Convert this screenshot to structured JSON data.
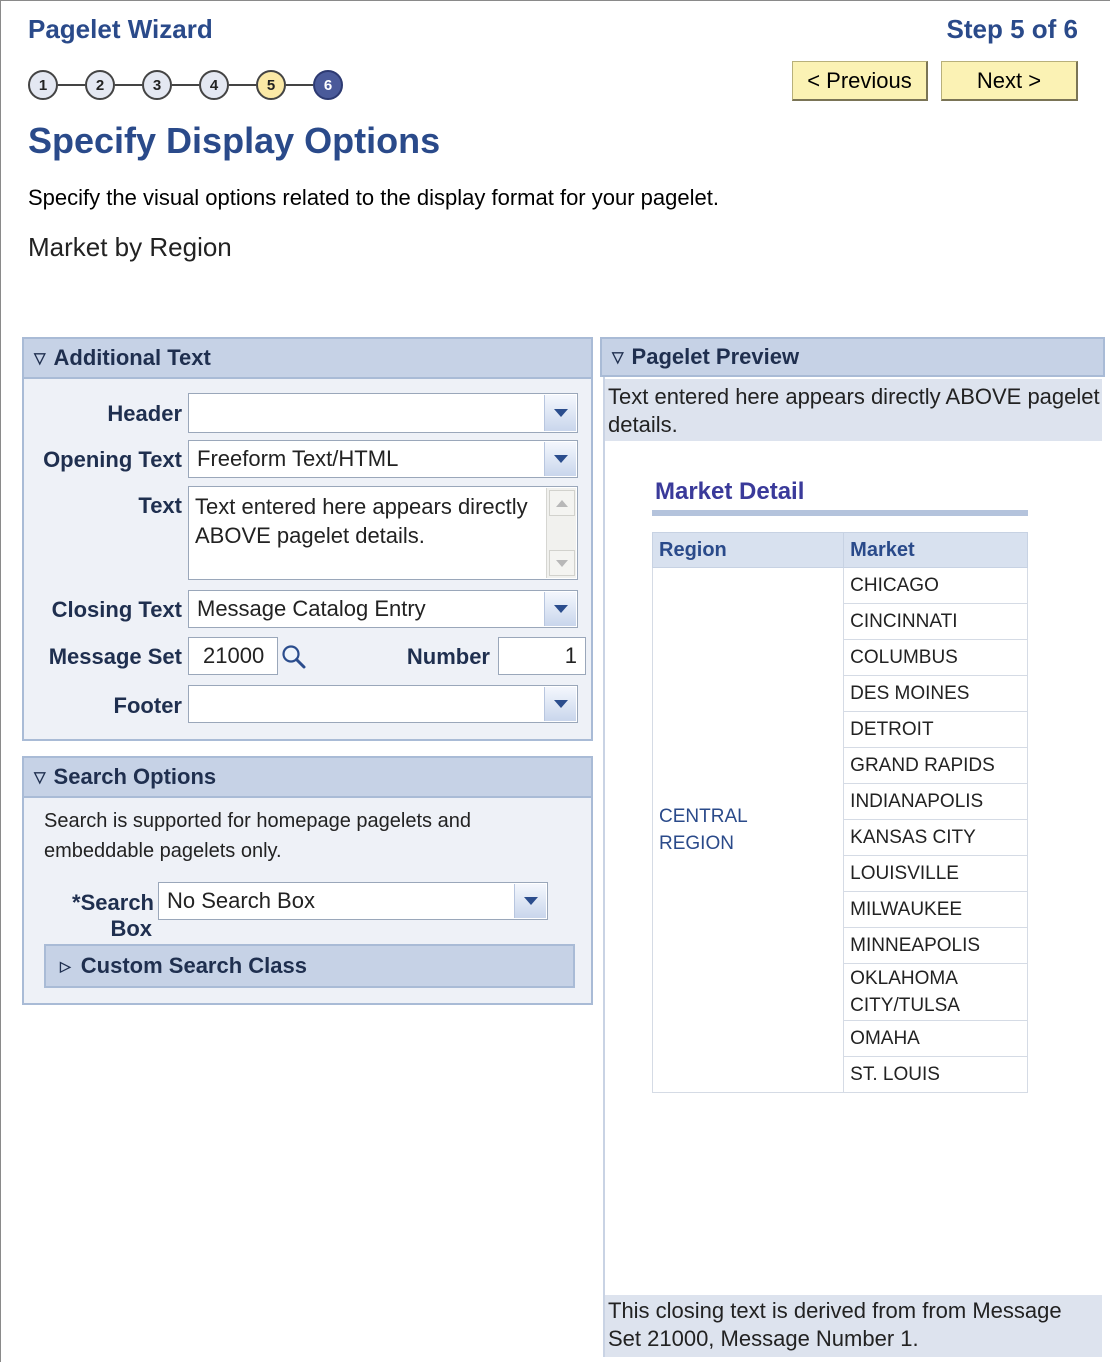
{
  "wizard": {
    "title": "Pagelet Wizard",
    "step_label": "Step 5 of 6",
    "steps": [
      "1",
      "2",
      "3",
      "4",
      "5",
      "6"
    ],
    "current_step": 5
  },
  "nav": {
    "previous": "< Previous",
    "next": "Next >"
  },
  "page": {
    "title": "Specify Display Options",
    "instructions": "Specify the visual options related to the display format for your pagelet.",
    "pagelet_name": "Market by Region"
  },
  "additional_text": {
    "header": "Additional Text",
    "header_label": "Header",
    "header_value": "",
    "opening_label": "Opening Text",
    "opening_value": "Freeform Text/HTML",
    "text_label": "Text",
    "text_value": "Text entered here appears directly ABOVE pagelet details.",
    "closing_label": "Closing Text",
    "closing_value": "Message Catalog Entry",
    "message_set_label": "Message Set",
    "message_set_value": "21000",
    "number_label": "Number",
    "number_value": "1",
    "footer_label": "Footer",
    "footer_value": ""
  },
  "search_options": {
    "header": "Search Options",
    "note_line1": "Search is supported for homepage pagelets and",
    "note_line2": "embeddable pagelets only.",
    "search_box_label_line1": "*Search",
    "search_box_label_line2": "Box",
    "search_box_value": "No Search Box",
    "custom_search_class": "Custom Search Class"
  },
  "preview": {
    "header": "Pagelet Preview",
    "opening_text": "Text entered here appears directly ABOVE pagelet details.",
    "table_title": "Market Detail",
    "col_region": "Region",
    "col_market": "Market",
    "region_line1": "CENTRAL",
    "region_line2": "REGION",
    "markets": [
      "CHICAGO",
      "CINCINNATI",
      "COLUMBUS",
      "DES MOINES",
      "DETROIT",
      "GRAND RAPIDS",
      "INDIANAPOLIS",
      "KANSAS CITY",
      "LOUISVILLE",
      "MILWAUKEE",
      "MINNEAPOLIS",
      "OKLAHOMA CITY/TULSA",
      "OMAHA",
      "ST. LOUIS"
    ],
    "closing_text": "This closing text is derived from from Message Set 21000, Message Number 1."
  },
  "icons": {
    "dropdown": "chevron-down-icon",
    "lookup": "magnifier-icon",
    "collapse": "triangle-down-icon",
    "expand": "triangle-right-icon"
  },
  "colors": {
    "title_blue": "#2a4a8a",
    "panel_header": "#c6d2e6",
    "panel_bg": "#eef1f7",
    "button_yellow": "#fbf2b4",
    "current_step": "#fbe9a6",
    "future_step": "#4a5a9a"
  }
}
